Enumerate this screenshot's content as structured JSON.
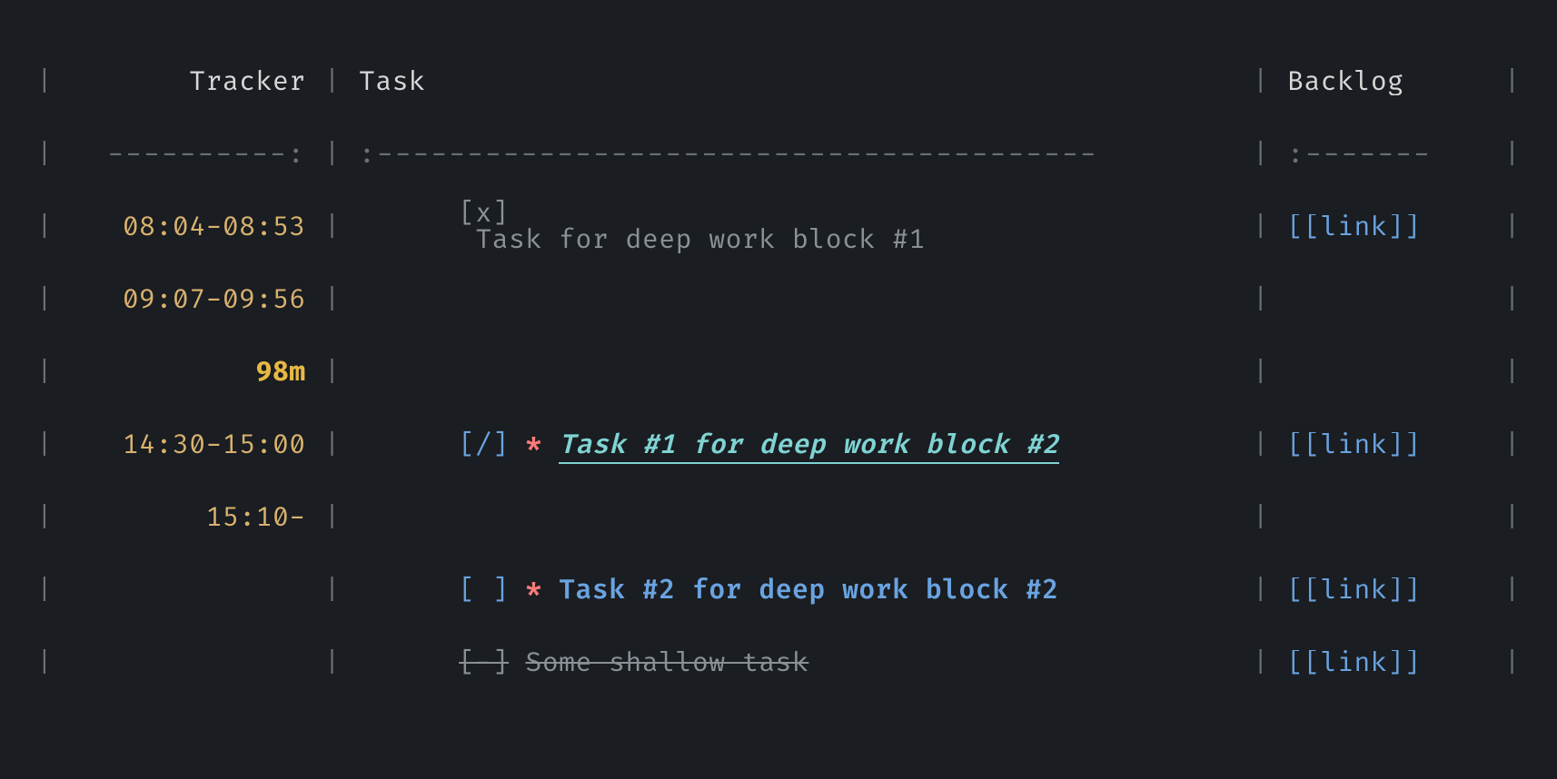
{
  "headers": {
    "tracker": "Tracker",
    "task": "Task",
    "backlog": "Backlog"
  },
  "sep": {
    "tracker": "----------:",
    "task": ":----------------------------------------",
    "backlog": ":-------"
  },
  "rows": [
    {
      "tracker": "08:04-08:53",
      "checkbox": "[x]",
      "task": "Task for deep work block #1",
      "link": "[[link]]",
      "style": "grey"
    },
    {
      "tracker": "09:07-09:56",
      "checkbox": "",
      "task": "",
      "link": "",
      "style": "grey"
    },
    {
      "tracker": "98m",
      "checkbox": "",
      "task": "",
      "link": "",
      "style": "timebold"
    },
    {
      "tracker": "14:30-15:00",
      "checkbox": "[/]",
      "star": "*",
      "task": "Task #1 for deep work block #2",
      "link": "[[link]]",
      "style": "active"
    },
    {
      "tracker": "15:10-",
      "checkbox": "",
      "task": "",
      "link": "",
      "style": "grey"
    },
    {
      "tracker": "",
      "checkbox": "[ ]",
      "star": "*",
      "task": "Task #2 for deep work block #2",
      "link": "[[link]]",
      "style": "blue"
    },
    {
      "tracker": "",
      "checkbox": "[-]",
      "task": "Some shallow task",
      "link": "[[link]]",
      "style": "strike"
    }
  ]
}
